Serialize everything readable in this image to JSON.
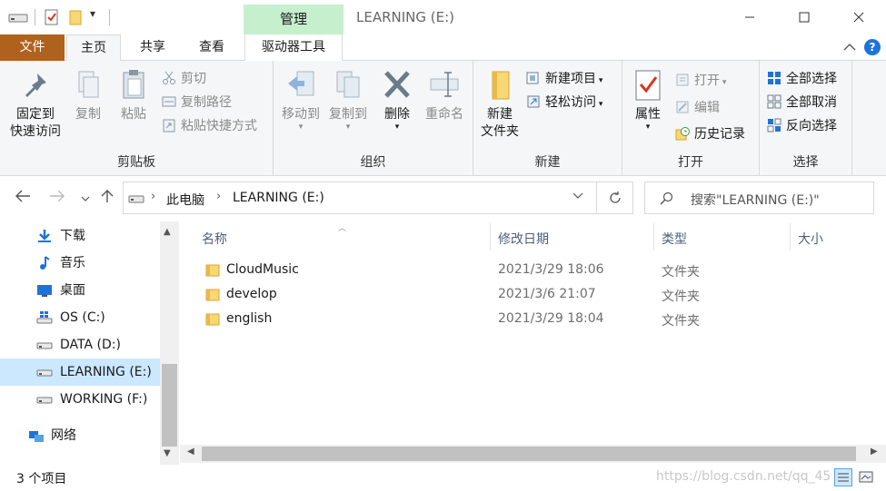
{
  "titlebar": {
    "contextual_tab": "管理",
    "window_title": "LEARNING (E:)",
    "quick_access_icons": [
      "drive-icon",
      "properties-icon",
      "new-folder-icon",
      "customize-dropdown-icon"
    ]
  },
  "tabs": {
    "file": "文件",
    "home": "主页",
    "share": "共享",
    "view": "查看",
    "drive_tools": "驱动器工具"
  },
  "ribbon": {
    "clipboard": {
      "label": "剪贴板",
      "pin_line1": "固定到",
      "pin_line2": "快速访问",
      "copy": "复制",
      "paste": "粘贴",
      "cut": "剪切",
      "copy_path": "复制路径",
      "paste_shortcut": "粘贴快捷方式"
    },
    "organize": {
      "label": "组织",
      "move_to": "移动到",
      "copy_to": "复制到",
      "delete": "删除",
      "rename": "重命名"
    },
    "new": {
      "label": "新建",
      "new_folder_line1": "新建",
      "new_folder_line2": "文件夹",
      "new_item": "新建项目",
      "easy_access": "轻松访问"
    },
    "open": {
      "label": "打开",
      "properties": "属性",
      "open": "打开",
      "edit": "编辑",
      "history": "历史记录"
    },
    "select": {
      "label": "选择",
      "select_all": "全部选择",
      "select_none": "全部取消",
      "invert": "反向选择"
    }
  },
  "address": {
    "crumbs": [
      "此电脑",
      "LEARNING (E:)"
    ]
  },
  "search": {
    "placeholder": "搜索\"LEARNING (E:)\""
  },
  "nav_items": [
    {
      "label": "下载",
      "icon": "download-icon"
    },
    {
      "label": "音乐",
      "icon": "music-icon"
    },
    {
      "label": "桌面",
      "icon": "desktop-icon"
    },
    {
      "label": "OS (C:)",
      "icon": "windows-drive-icon"
    },
    {
      "label": "DATA (D:)",
      "icon": "drive-icon"
    },
    {
      "label": "LEARNING (E:)",
      "icon": "drive-icon",
      "selected": true
    },
    {
      "label": "WORKING (F:)",
      "icon": "drive-icon"
    },
    {
      "label": "网络",
      "icon": "network-icon"
    }
  ],
  "columns": {
    "name": "名称",
    "date": "修改日期",
    "type": "类型",
    "size": "大小"
  },
  "files": [
    {
      "name": "CloudMusic",
      "date": "2021/3/29 18:06",
      "type": "文件夹",
      "size": ""
    },
    {
      "name": "develop",
      "date": "2021/3/6 21:07",
      "type": "文件夹",
      "size": ""
    },
    {
      "name": "english",
      "date": "2021/3/29 18:04",
      "type": "文件夹",
      "size": ""
    }
  ],
  "status": {
    "count": "3 个项目",
    "watermark": "https://blog.csdn.net/qq_45"
  },
  "colors": {
    "file_tab": "#b0611e",
    "contextual_tab": "#c6efce",
    "selection": "#cce8ff",
    "folder": "#f8d775",
    "accent_blue": "#1e73d8"
  }
}
